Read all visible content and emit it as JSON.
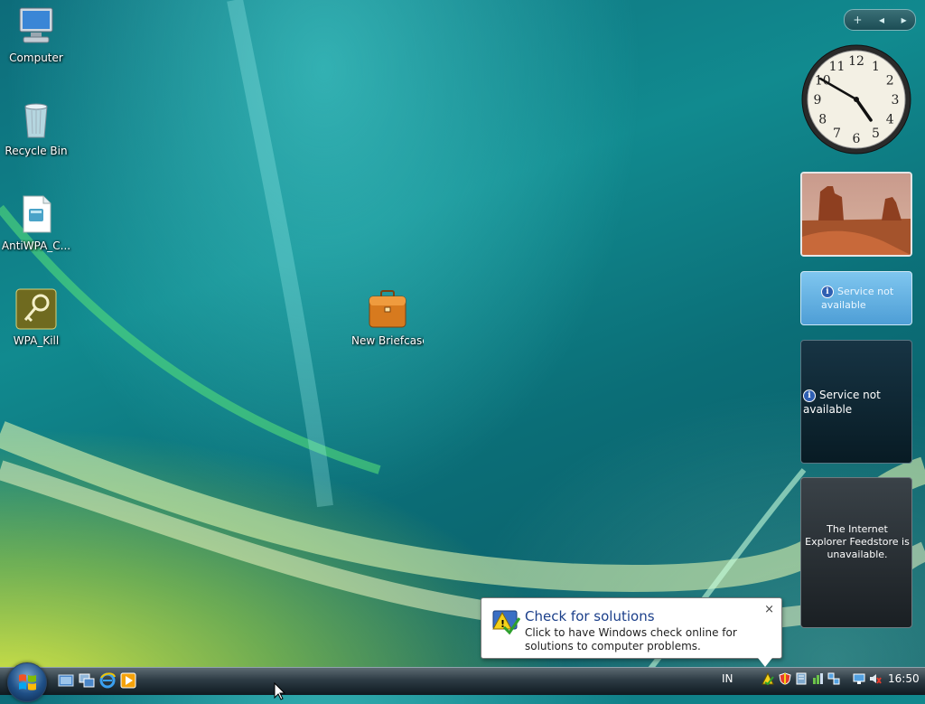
{
  "desktop": {
    "icons": [
      {
        "label": "Computer"
      },
      {
        "label": "Recycle Bin"
      },
      {
        "label": "AntiWPA_C..."
      },
      {
        "label": "WPA_Kill"
      },
      {
        "label": "New Briefcase"
      }
    ]
  },
  "sidebar": {
    "toolbar": {
      "add": "+",
      "prev": "◂",
      "next": "▸"
    },
    "clock": {
      "hour": 16,
      "minute": 50,
      "numerals": [
        "12",
        "1",
        "2",
        "3",
        "4",
        "5",
        "6",
        "7",
        "8",
        "9",
        "10",
        "11"
      ]
    },
    "weather": {
      "message": "Service not available"
    },
    "cpu": {
      "message": "Service not available"
    },
    "feed": {
      "message": "The Internet Explorer Feedstore is unavailable."
    }
  },
  "balloon": {
    "title": "Check for solutions",
    "body": "Click to have Windows check online for solutions to computer problems.",
    "close": "×"
  },
  "taskbar": {
    "language": "IN",
    "time": "16:50",
    "quick_launch": [
      "show-desktop-icon",
      "switch-windows-icon",
      "internet-explorer-icon",
      "media-player-icon"
    ],
    "tray": [
      "problem-reports-icon",
      "security-shield-icon",
      "network-adapter-icon",
      "volume-mixer-icon",
      "network-icon",
      "display-icon",
      "volume-muted-icon"
    ]
  },
  "colors": {
    "accent": "#1b3f8a",
    "taskbar": "#1e2b33"
  }
}
